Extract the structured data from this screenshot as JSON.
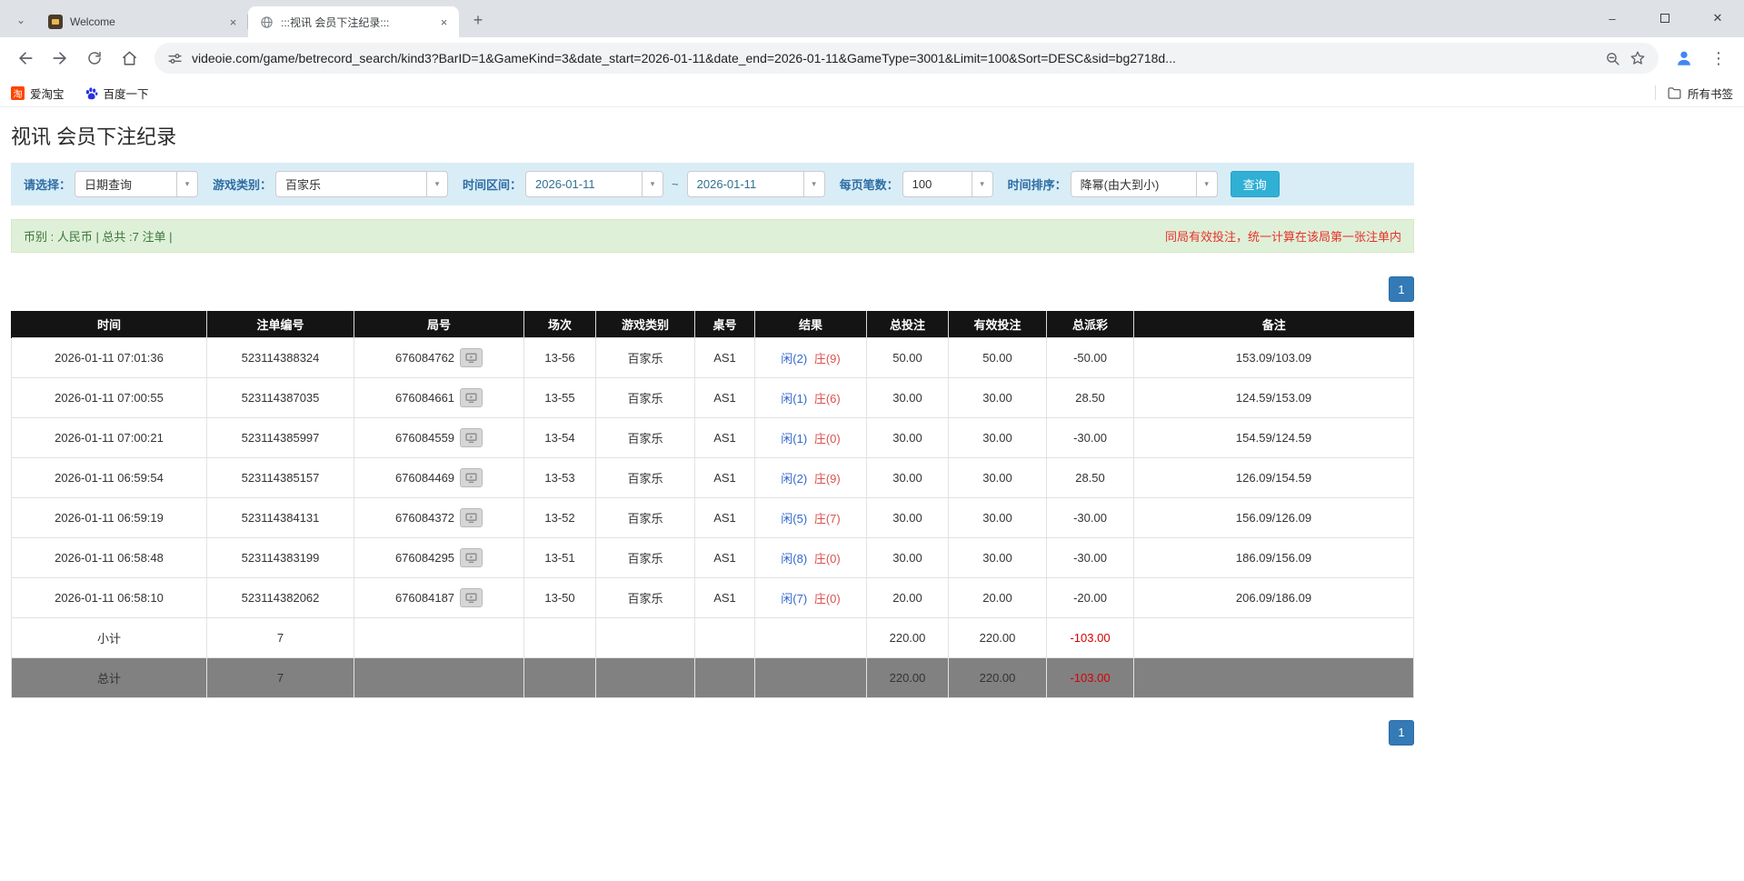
{
  "browser": {
    "tabs": [
      {
        "title": "Welcome"
      },
      {
        "title": ":::视讯 会员下注纪录:::"
      }
    ],
    "url": "videoie.com/game/betrecord_search/kind3?BarID=1&GameKind=3&date_start=2026-01-11&date_end=2026-01-11&GameType=3001&Limit=100&Sort=DESC&sid=bg2718d...",
    "bookmarks": [
      {
        "label": "爱淘宝",
        "icon_glyph": "淘"
      },
      {
        "label": "百度一下"
      }
    ],
    "all_bookmarks": "所有书签"
  },
  "icons": {
    "tab_search": "⌄",
    "new_tab": "+",
    "close_tab": "×",
    "minimize": "–",
    "close": "✕",
    "menu": "⋮",
    "caret_down": "▾"
  },
  "colors": {
    "accent_blue": "#337ab7",
    "button_cyan": "#31b0d5",
    "negative_red": "#e00000",
    "player_blue": "#3366cc",
    "banker_red": "#d9534f",
    "filter_bg": "#d9edf7",
    "notice_bg": "#dff0d8",
    "table_header_bg": "#141414",
    "summary_bg": "#8e8e8e"
  },
  "page": {
    "title": "视讯 会员下注纪录",
    "filters": {
      "select_label": "请选择：",
      "select_value": "日期查询",
      "game_type_label": "游戏类别：",
      "game_type_value": "百家乐",
      "date_range_label": "时间区间：",
      "date_start": "2026-01-11",
      "date_separator": "~",
      "date_end": "2026-01-11",
      "per_page_label": "每页笔数：",
      "per_page_value": "100",
      "sort_label": "时间排序：",
      "sort_value": "降幂(由大到小)",
      "search_button": "查询"
    },
    "info_bar": {
      "left": "币别 : 人民币 | 总共 :7 注单 |",
      "right": "同局有效投注，统一计算在该局第一张注单内"
    },
    "pagination": "1",
    "table": {
      "headers": [
        "时间",
        "注单编号",
        "局号",
        "场次",
        "游戏类别",
        "桌号",
        "结果",
        "总投注",
        "有效投注",
        "总派彩",
        "备注"
      ],
      "rows": [
        {
          "time": "2026-01-11 07:01:36",
          "bet_id": "523114388324",
          "round": "676084762",
          "session": "13-56",
          "game": "百家乐",
          "table_no": "AS1",
          "result_player": "闲(2)",
          "result_banker": "庄(9)",
          "total_bet": "50.00",
          "valid_bet": "50.00",
          "payout": "-50.00",
          "note": "153.09/103.09"
        },
        {
          "time": "2026-01-11 07:00:55",
          "bet_id": "523114387035",
          "round": "676084661",
          "session": "13-55",
          "game": "百家乐",
          "table_no": "AS1",
          "result_player": "闲(1)",
          "result_banker": "庄(6)",
          "total_bet": "30.00",
          "valid_bet": "30.00",
          "payout": "28.50",
          "note": "124.59/153.09"
        },
        {
          "time": "2026-01-11 07:00:21",
          "bet_id": "523114385997",
          "round": "676084559",
          "session": "13-54",
          "game": "百家乐",
          "table_no": "AS1",
          "result_player": "闲(1)",
          "result_banker": "庄(0)",
          "total_bet": "30.00",
          "valid_bet": "30.00",
          "payout": "-30.00",
          "note": "154.59/124.59"
        },
        {
          "time": "2026-01-11 06:59:54",
          "bet_id": "523114385157",
          "round": "676084469",
          "session": "13-53",
          "game": "百家乐",
          "table_no": "AS1",
          "result_player": "闲(2)",
          "result_banker": "庄(9)",
          "total_bet": "30.00",
          "valid_bet": "30.00",
          "payout": "28.50",
          "note": "126.09/154.59"
        },
        {
          "time": "2026-01-11 06:59:19",
          "bet_id": "523114384131",
          "round": "676084372",
          "session": "13-52",
          "game": "百家乐",
          "table_no": "AS1",
          "result_player": "闲(5)",
          "result_banker": "庄(7)",
          "total_bet": "30.00",
          "valid_bet": "30.00",
          "payout": "-30.00",
          "note": "156.09/126.09"
        },
        {
          "time": "2026-01-11 06:58:48",
          "bet_id": "523114383199",
          "round": "676084295",
          "session": "13-51",
          "game": "百家乐",
          "table_no": "AS1",
          "result_player": "闲(8)",
          "result_banker": "庄(0)",
          "total_bet": "30.00",
          "valid_bet": "30.00",
          "payout": "-30.00",
          "note": "186.09/156.09"
        },
        {
          "time": "2026-01-11 06:58:10",
          "bet_id": "523114382062",
          "round": "676084187",
          "session": "13-50",
          "game": "百家乐",
          "table_no": "AS1",
          "result_player": "闲(7)",
          "result_banker": "庄(0)",
          "total_bet": "20.00",
          "valid_bet": "20.00",
          "payout": "-20.00",
          "note": "206.09/186.09"
        }
      ],
      "subtotal": {
        "label": "小计",
        "count": "7",
        "total_bet": "220.00",
        "valid_bet": "220.00",
        "payout": "-103.00"
      },
      "total": {
        "label": "总计",
        "count": "7",
        "total_bet": "220.00",
        "valid_bet": "220.00",
        "payout": "-103.00"
      }
    }
  }
}
